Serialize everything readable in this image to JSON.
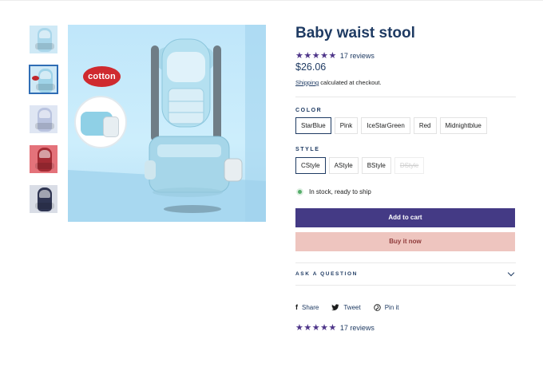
{
  "product": {
    "title": "Baby waist stool",
    "stars": "★★★★★",
    "reviews": "17 reviews",
    "price": "$26.06",
    "shipping_link": "Shipping",
    "shipping_text": " calculated at checkout."
  },
  "gallery": {
    "badge": "cotton",
    "thumbnails": [
      {
        "name": "thumb-1",
        "bg": "#cfe9f6",
        "carrier": "#a9d6ea",
        "tag": false
      },
      {
        "name": "thumb-2",
        "bg": "#cfe9f6",
        "carrier": "#9fd3e8",
        "tag": true
      },
      {
        "name": "thumb-3",
        "bg": "#dfe6f3",
        "carrier": "#b9c3df",
        "tag": false
      },
      {
        "name": "thumb-4",
        "bg": "#e4727a",
        "carrier": "#a32b34",
        "tag": false
      },
      {
        "name": "thumb-5",
        "bg": "#d9dde6",
        "carrier": "#2f3552",
        "tag": false
      }
    ]
  },
  "options": {
    "color_label": "COLOR",
    "colors": [
      "StarBlue",
      "Pink",
      "IceStarGreen",
      "Red",
      "Midnightblue"
    ],
    "color_selected": 0,
    "style_label": "STYLE",
    "styles": [
      "CStyle",
      "AStyle",
      "BStyle",
      "DStyle"
    ],
    "style_selected": 0,
    "style_disabled": 3
  },
  "stock_text": "In stock, ready to ship",
  "buttons": {
    "add_to_cart": "Add to cart",
    "buy_now": "Buy it now"
  },
  "ask_question": "ASK A QUESTION",
  "social": {
    "share": "Share",
    "tweet": "Tweet",
    "pin": "Pin it"
  },
  "colors": {
    "accent": "#443a85",
    "buy": "#eec5bf",
    "title": "#1f3b63",
    "stars": "#4e3589"
  }
}
